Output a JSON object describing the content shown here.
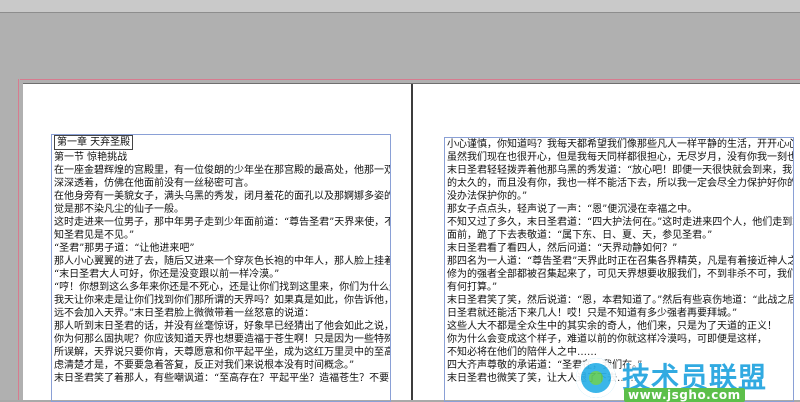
{
  "left_page": {
    "lines": [
      "第一章 天弃圣殿",
      "第一节 惊艳挑战",
      "在一座金碧辉煌的宫殿里，有一位俊朗的少年坐在那宫殿的最高处，他那一双深黑色的双眼",
      "深深透着，仿佛在他面前没有一丝秘密可言。",
      "在他身旁有一美貌女子，满头乌黑的秀发，闭月羞花的面孔以及那婀娜多姿的身材，让人感",
      "觉是那不染凡尘的仙子一般。",
      "这时走进来一位男子，那中年男子走到少年面前道：“尊告圣君”天界来使，不",
      "知圣君见是不见。”",
      "“圣君”那男子道：“让他进来吧”",
      "那人小心翼翼的进了去，随后又进来一个穿灰色长袍的中年人，那人脸上挂着一丝微笑道：",
      "“末日圣君大人可好，你还是没变跟以前一样冷漠。”",
      "“哼！你想到这么多年来你还是不死心，还是让你们找到这里来，你们为什么还要缠着我？",
      "我天让你来走是让你们找到你们那所谓的天界吗？如果真是如此，你告诉他，我末日圣君永",
      "远不会加入天界。”末日圣君脸上微微带着一丝怒意的说道：",
      "那人听到末日圣君的话，并没有丝毫惊讶，好象早已经猜出了他会如此之说，继续道：“末日",
      "你为何那么固执呢？你应该知道天界也想要造福于苍生啊！只是因为一些特殊原因，所以有",
      "所误解，天界说只要你肯，天尊愿意和你平起平坐，成为这红万里灵中的至高存在！你要考",
      "虑清楚才是，不要要急着答复，反正对我们来说根本没有时间概念。”",
      "末日圣君笑了着那人，有些嘲讽道：“至高存在？平起平坐？造福苍生？不要以为本君不知"
    ]
  },
  "right_page": {
    "lines": [
      "小心谨慎，你知道吗？我每天都希望我们像那些凡人一样平静的生活，开开心心过每一天！",
      "虽然我们现在也很开心，但是我每天同样都很担心，无尽岁月，没有你我一刻也活不下去。”",
      "末日圣君轻轻拨弄着他那乌黑的秀发道：“放心吧！即便一天很快就会到来，我不会让你等",
      "的太久的，而且没有你，我也一样不能活下去，所以我一定会尽全力保护好你的，不要让我",
      "没办法保护你的。”",
      "那女子点点头，轻声说了一声：“恩”便沉浸在幸福之中。",
      "不知又过了多久，末日圣君道：“四大护法何在。”这时走进来四个人，他们走到末日圣君",
      "面前，跪了下去表敬道：“属下东、日、夏、天，参见圣君。”",
      "末日圣君看了看四人，然后问道：“天界动静如何？”",
      "那四名为一人道：“尊告圣君”天界此时正在召集各界精英，凡是有着接近神人之境",
      "修为的强者全部都被召集起来了，可见天界想要收服我们，不到非杀不可，我们是一次生死，不知圣君",
      "有何打算。”",
      "末日圣君笑了笑，然后说道：“恩，本君知道了。”然后有些哀伤地道：“此战之后我末",
      "日圣君就还能活下来几人！哎！只是不知道有多少强者再要拜城。”",
      "这些人大不都是全众生中的其实余的奇人，他们来，只是为了天道的正义！",
      "你为什么会变成这个样子，难道以前的你就这样冷漠吗，可即便是这样，",
      "不知必将在他们的陪伴人之中……",
      "四大齐声尊敬的承诺道：“圣君在，我们在。”",
      "末日圣君也微笑了笑，让大人退了下去……"
    ]
  },
  "watermark": {
    "logo_icon": "chat-bubble-logo-icon",
    "brand_name": "技术员联盟",
    "url": "www.jsgho.com"
  }
}
